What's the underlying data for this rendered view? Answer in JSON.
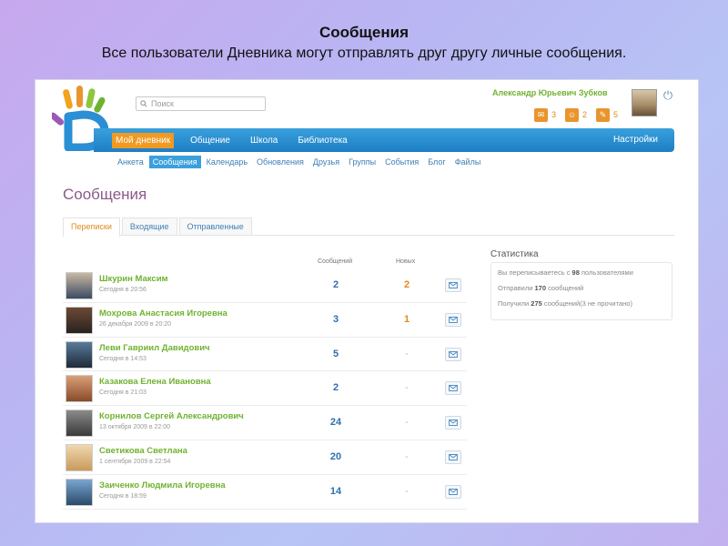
{
  "slide": {
    "title": "Сообщения",
    "subtitle": "Все пользователи Дневника могут отправлять друг другу личные сообщения."
  },
  "search": {
    "placeholder": "Поиск"
  },
  "user": {
    "name": "Александр Юрьевич Зубков",
    "badges": [
      {
        "icon": "envelope-icon",
        "count": "3"
      },
      {
        "icon": "person-icon",
        "count": "2"
      },
      {
        "icon": "pencil-icon",
        "count": "5"
      }
    ]
  },
  "nav": {
    "items": [
      "Мой дневник",
      "Общение",
      "Школа",
      "Библиотека"
    ],
    "active": 0,
    "settings": "Настройки"
  },
  "subnav": {
    "items": [
      "Анкета",
      "Сообщения",
      "Календарь",
      "Обновления",
      "Друзья",
      "Группы",
      "События",
      "Блог",
      "Файлы"
    ],
    "active": 1
  },
  "page": {
    "title": "Сообщения"
  },
  "tabs": {
    "items": [
      "Переписки",
      "Входящие",
      "Отправленные"
    ],
    "active": 0
  },
  "table": {
    "col_messages": "Сообщений",
    "col_new": "Новых",
    "rows": [
      {
        "name": "Шкурин Максим",
        "date": "Сегодня в 20:56",
        "messages": "2",
        "new": "2"
      },
      {
        "name": "Мохрова Анастасия Игоревна",
        "date": "26 декабря 2009 в 20:20",
        "messages": "3",
        "new": "1"
      },
      {
        "name": "Леви Гавриил Давидович",
        "date": "Сегодня в 14:53",
        "messages": "5",
        "new": "-"
      },
      {
        "name": "Казакова Елена Ивановна",
        "date": "Сегодня в 21:03",
        "messages": "2",
        "new": "-"
      },
      {
        "name": "Корнилов Сергей Александрович",
        "date": "13 октября 2009 в 22:00",
        "messages": "24",
        "new": "-"
      },
      {
        "name": "Светикова Светлана",
        "date": "1 сентября 2009 в 22:54",
        "messages": "20",
        "new": "-"
      },
      {
        "name": "Заиченко Людмила Игоревна",
        "date": "Сегодня в 18:59",
        "messages": "14",
        "new": "-"
      }
    ]
  },
  "stats": {
    "title": "Статистика",
    "lines": [
      {
        "pre": "Вы переписываетесь с ",
        "num": "98",
        "post": " пользователями"
      },
      {
        "pre": "Отправили ",
        "num": "170",
        "post": " сообщений"
      },
      {
        "pre": "Получили ",
        "num": "275",
        "post": " сообщений(3 не прочитано)"
      }
    ]
  },
  "colors": {
    "accent_orange": "#e8952e",
    "nav_blue": "#1d7ec4",
    "name_green": "#6fb22f"
  }
}
